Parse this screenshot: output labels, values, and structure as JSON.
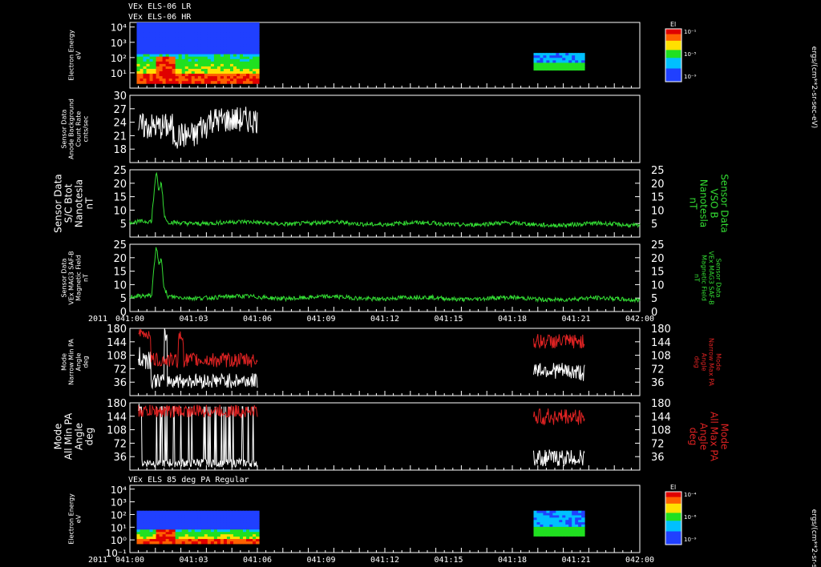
{
  "header": {
    "line1": "VEx ELS-06 LR",
    "line2": "VEx ELS-06 HR",
    "bottom_title": "VEx ELS 85 deg PA Regular"
  },
  "time_axis": {
    "year_label": "2011",
    "ticks": [
      "041:00",
      "041:03",
      "041:06",
      "041:09",
      "041:12",
      "041:15",
      "041:18",
      "041:21",
      "042:00"
    ],
    "range_minutes": [
      0,
      60
    ]
  },
  "colorbar": {
    "title": "El",
    "unit_label": "ergs/(cm**2-sr-sec-eV)",
    "top_ticks": [
      "10⁻¹",
      "10⁻⁵",
      "10⁻⁹"
    ],
    "bottom_ticks": [
      "10⁻⁴",
      "10⁻⁶",
      "10⁻⁹"
    ]
  },
  "chart_data": [
    {
      "id": "panel1",
      "type": "heatmap",
      "ylabel": [
        "Electron Energy",
        "eV"
      ],
      "yscale": "log",
      "ylim": [
        1,
        20000
      ],
      "yticks": [
        {
          "v": 10000,
          "t": "10⁴"
        },
        {
          "v": 1000,
          "t": "10³"
        },
        {
          "v": 100,
          "t": "10²"
        },
        {
          "v": 10,
          "t": "10¹"
        }
      ],
      "blocks": [
        {
          "t0": 0.8,
          "t1": 15.2,
          "e0": 2,
          "e1": 20000
        },
        {
          "t0": 47.5,
          "t1": 53.5,
          "e0": 15,
          "e1": 200
        }
      ]
    },
    {
      "id": "panel2",
      "type": "line",
      "ylabel": [
        "Sensor Data",
        "Anode Background",
        "Count Rate",
        "cnts/sec"
      ],
      "ylim": [
        15,
        30
      ],
      "yticks": [
        {
          "v": 30,
          "t": "30"
        },
        {
          "v": 27,
          "t": "27"
        },
        {
          "v": 24,
          "t": "24"
        },
        {
          "v": 21,
          "t": "21"
        },
        {
          "v": 18,
          "t": "18"
        }
      ],
      "series": [
        {
          "color": "#ffffff",
          "segments": [
            {
              "t0": 1.0,
              "t1": 15.0,
              "shape": "background"
            }
          ]
        }
      ]
    },
    {
      "id": "panel3",
      "type": "line",
      "ylabel": [
        "Sensor Data",
        "S/C Btot",
        "Nanotesla",
        "nT"
      ],
      "ylabel_right": [
        "Sensor Data",
        "VSO B",
        "Nanotesla",
        "nT"
      ],
      "ylim": [
        0,
        25
      ],
      "yticks": [
        {
          "v": 25,
          "t": "25"
        },
        {
          "v": 20,
          "t": "20"
        },
        {
          "v": 15,
          "t": "15"
        },
        {
          "v": 10,
          "t": "10"
        },
        {
          "v": 5,
          "t": "5"
        }
      ],
      "series": [
        {
          "color": "#33dd33",
          "segments": [
            {
              "t0": 0,
              "t1": 60,
              "shape": "field"
            }
          ]
        }
      ]
    },
    {
      "id": "panel4",
      "type": "line",
      "ylabel": [
        "Sensor Data",
        "VEx MAG3 SAF-B",
        "Magnetic Field",
        "nT"
      ],
      "ylabel_right": [
        "Sensor Data",
        "VEx MAG3 SAF-B",
        "Magnetic Field",
        "nT"
      ],
      "ylim": [
        0,
        25
      ],
      "yticks": [
        {
          "v": 25,
          "t": "25"
        },
        {
          "v": 20,
          "t": "20"
        },
        {
          "v": 15,
          "t": "15"
        },
        {
          "v": 10,
          "t": "10"
        },
        {
          "v": 5,
          "t": "5"
        },
        {
          "v": 0,
          "t": "0"
        }
      ],
      "series": [
        {
          "color": "#33dd33",
          "segments": [
            {
              "t0": 0,
              "t1": 60,
              "shape": "field"
            }
          ]
        }
      ]
    },
    {
      "id": "panel5",
      "type": "line",
      "ylabel": [
        "Mode",
        "Narrow Min PA",
        "Angle",
        "deg"
      ],
      "ylabel_right": [
        "Mode",
        "Narrow Max PA",
        "Angle",
        "deg"
      ],
      "ylim": [
        0,
        180
      ],
      "yticks": [
        {
          "v": 180,
          "t": "180"
        },
        {
          "v": 144,
          "t": "144"
        },
        {
          "v": 108,
          "t": "108"
        },
        {
          "v": 72,
          "t": "72"
        },
        {
          "v": 36,
          "t": "36"
        }
      ],
      "series": [
        {
          "color": "#ffffff",
          "segments": [
            {
              "t0": 1.0,
              "t1": 15.0,
              "shape": "narrowmin1"
            },
            {
              "t0": 47.5,
              "t1": 53.5,
              "shape": "narrowmin2"
            }
          ]
        },
        {
          "color": "#dd2222",
          "segments": [
            {
              "t0": 1.0,
              "t1": 15.0,
              "shape": "narrowmax1"
            },
            {
              "t0": 47.5,
              "t1": 53.5,
              "shape": "narrowmax2"
            }
          ]
        }
      ]
    },
    {
      "id": "panel6",
      "type": "line",
      "ylabel": [
        "Mode",
        "All Min PA",
        "Angle",
        "deg"
      ],
      "ylabel_right": [
        "Mode",
        "All Max PA",
        "Angle",
        "deg"
      ],
      "ylim": [
        0,
        180
      ],
      "yticks": [
        {
          "v": 180,
          "t": "180"
        },
        {
          "v": 144,
          "t": "144"
        },
        {
          "v": 108,
          "t": "108"
        },
        {
          "v": 72,
          "t": "72"
        },
        {
          "v": 36,
          "t": "36"
        }
      ],
      "series": [
        {
          "color": "#ffffff",
          "segments": [
            {
              "t0": 1.0,
              "t1": 15.0,
              "shape": "allmin1"
            },
            {
              "t0": 47.5,
              "t1": 53.5,
              "shape": "allmin2"
            }
          ]
        },
        {
          "color": "#dd2222",
          "segments": [
            {
              "t0": 1.0,
              "t1": 15.0,
              "shape": "allmax1"
            },
            {
              "t0": 47.5,
              "t1": 53.5,
              "shape": "allmax2"
            }
          ]
        }
      ]
    },
    {
      "id": "panel7",
      "type": "heatmap",
      "ylabel": [
        "Electron Energy",
        "eV"
      ],
      "yscale": "log",
      "ylim": [
        0.1,
        20000
      ],
      "yticks": [
        {
          "v": 10000,
          "t": "10⁴"
        },
        {
          "v": 1000,
          "t": "10³"
        },
        {
          "v": 100,
          "t": "10²"
        },
        {
          "v": 10,
          "t": "10¹"
        },
        {
          "v": 1,
          "t": "10⁰"
        },
        {
          "v": 0.1,
          "t": "10⁻¹"
        }
      ],
      "blocks": [
        {
          "t0": 0.8,
          "t1": 15.2,
          "e0": 0.5,
          "e1": 200
        },
        {
          "t0": 47.5,
          "t1": 53.5,
          "e0": 2,
          "e1": 200
        }
      ]
    }
  ]
}
